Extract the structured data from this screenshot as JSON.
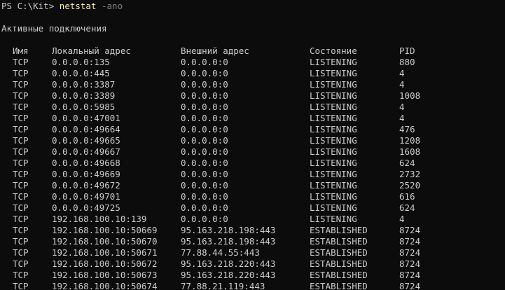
{
  "prompt": {
    "text": "PS C:\\Kit> ",
    "command": "netstat",
    "args": " -ano"
  },
  "heading": "Активные подключения",
  "columns": {
    "proto": "Имя",
    "local": "Локальный адрес",
    "foreign": "Внешний адрес",
    "state": "Состояние",
    "pid": "PID"
  },
  "rows": [
    {
      "proto": "TCP",
      "local": "0.0.0.0:135",
      "foreign": "0.0.0.0:0",
      "state": "LISTENING",
      "pid": "880"
    },
    {
      "proto": "TCP",
      "local": "0.0.0.0:445",
      "foreign": "0.0.0.0:0",
      "state": "LISTENING",
      "pid": "4"
    },
    {
      "proto": "TCP",
      "local": "0.0.0.0:3387",
      "foreign": "0.0.0.0:0",
      "state": "LISTENING",
      "pid": "4"
    },
    {
      "proto": "TCP",
      "local": "0.0.0.0:3389",
      "foreign": "0.0.0.0:0",
      "state": "LISTENING",
      "pid": "1008"
    },
    {
      "proto": "TCP",
      "local": "0.0.0.0:5985",
      "foreign": "0.0.0.0:0",
      "state": "LISTENING",
      "pid": "4"
    },
    {
      "proto": "TCP",
      "local": "0.0.0.0:47001",
      "foreign": "0.0.0.0:0",
      "state": "LISTENING",
      "pid": "4"
    },
    {
      "proto": "TCP",
      "local": "0.0.0.0:49664",
      "foreign": "0.0.0.0:0",
      "state": "LISTENING",
      "pid": "476"
    },
    {
      "proto": "TCP",
      "local": "0.0.0.0:49665",
      "foreign": "0.0.0.0:0",
      "state": "LISTENING",
      "pid": "1208"
    },
    {
      "proto": "TCP",
      "local": "0.0.0.0:49667",
      "foreign": "0.0.0.0:0",
      "state": "LISTENING",
      "pid": "1608"
    },
    {
      "proto": "TCP",
      "local": "0.0.0.0:49668",
      "foreign": "0.0.0.0:0",
      "state": "LISTENING",
      "pid": "624"
    },
    {
      "proto": "TCP",
      "local": "0.0.0.0:49669",
      "foreign": "0.0.0.0:0",
      "state": "LISTENING",
      "pid": "2732"
    },
    {
      "proto": "TCP",
      "local": "0.0.0.0:49672",
      "foreign": "0.0.0.0:0",
      "state": "LISTENING",
      "pid": "2520"
    },
    {
      "proto": "TCP",
      "local": "0.0.0.0:49701",
      "foreign": "0.0.0.0:0",
      "state": "LISTENING",
      "pid": "616"
    },
    {
      "proto": "TCP",
      "local": "0.0.0.0:49725",
      "foreign": "0.0.0.0:0",
      "state": "LISTENING",
      "pid": "624"
    },
    {
      "proto": "TCP",
      "local": "192.168.100.10:139",
      "foreign": "0.0.0.0:0",
      "state": "LISTENING",
      "pid": "4"
    },
    {
      "proto": "TCP",
      "local": "192.168.100.10:50669",
      "foreign": "95.163.218.198:443",
      "state": "ESTABLISHED",
      "pid": "8724"
    },
    {
      "proto": "TCP",
      "local": "192.168.100.10:50670",
      "foreign": "95.163.218.198:443",
      "state": "ESTABLISHED",
      "pid": "8724"
    },
    {
      "proto": "TCP",
      "local": "192.168.100.10:50671",
      "foreign": "77.88.44.55:443",
      "state": "ESTABLISHED",
      "pid": "8724"
    },
    {
      "proto": "TCP",
      "local": "192.168.100.10:50672",
      "foreign": "95.163.218.220:443",
      "state": "ESTABLISHED",
      "pid": "8724"
    },
    {
      "proto": "TCP",
      "local": "192.168.100.10:50673",
      "foreign": "95.163.218.220:443",
      "state": "ESTABLISHED",
      "pid": "8724"
    },
    {
      "proto": "TCP",
      "local": "192.168.100.10:50674",
      "foreign": "77.88.21.119:443",
      "state": "ESTABLISHED",
      "pid": "8724"
    }
  ],
  "colors": {
    "background": "#0c0c0c",
    "text": "#cccccc",
    "command": "#f9f1a5",
    "parameter": "#808080"
  }
}
